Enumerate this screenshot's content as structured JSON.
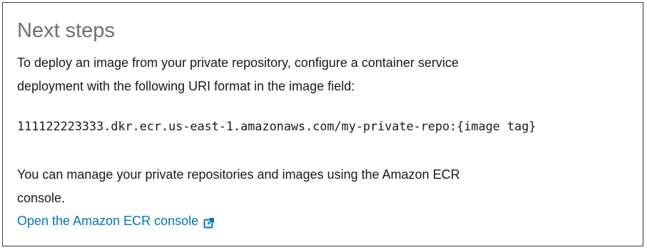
{
  "panel": {
    "title": "Next steps",
    "description_line1": "To deploy an image from your private repository, configure a container service",
    "description_line2": "deployment with the following URI format in the image field:",
    "uri": "111122223333.dkr.ecr.us-east-1.amazonaws.com/my-private-repo:{image tag}",
    "manage_line1": "You can manage your private repositories and images using the Amazon ECR",
    "manage_line2": "console.",
    "link_label": "Open the Amazon ECR console",
    "link_icon": "external-link-icon"
  },
  "colors": {
    "title": "#6b7178",
    "text": "#16191f",
    "link": "#0073bb",
    "border": "#3a3a3a"
  }
}
